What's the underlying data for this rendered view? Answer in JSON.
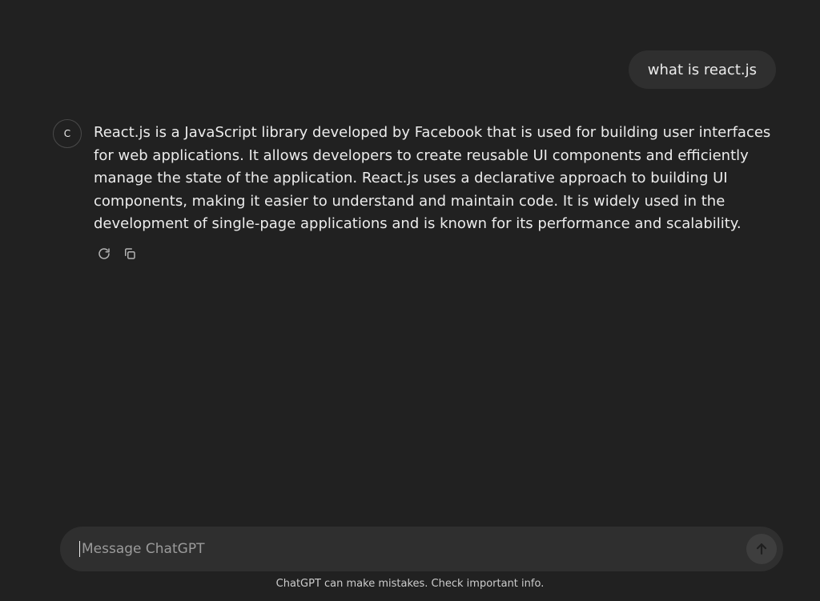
{
  "conversation": {
    "user_message": "what is react.js",
    "assistant": {
      "avatar_letter": "C",
      "message": "React.js is a JavaScript library developed by Facebook that is used for building user interfaces for web applications. It allows developers to create reusable UI components and efficiently manage the state of the application. React.js uses a declarative approach to building UI components, making it easier to understand and maintain code. It is widely used in the development of single-page applications and is known for its performance and scalability.",
      "actions": [
        {
          "name": "regenerate",
          "icon": "refresh-icon"
        },
        {
          "name": "copy",
          "icon": "copy-icon"
        }
      ]
    }
  },
  "composer": {
    "placeholder": "Message ChatGPT",
    "value": "",
    "send_icon": "arrow-up-icon"
  },
  "footer": {
    "disclaimer": "ChatGPT can make mistakes. Check important info."
  },
  "colors": {
    "background": "#212121",
    "bubble": "#2f2f2f",
    "text": "#ececec",
    "muted": "#9b9b9b"
  }
}
